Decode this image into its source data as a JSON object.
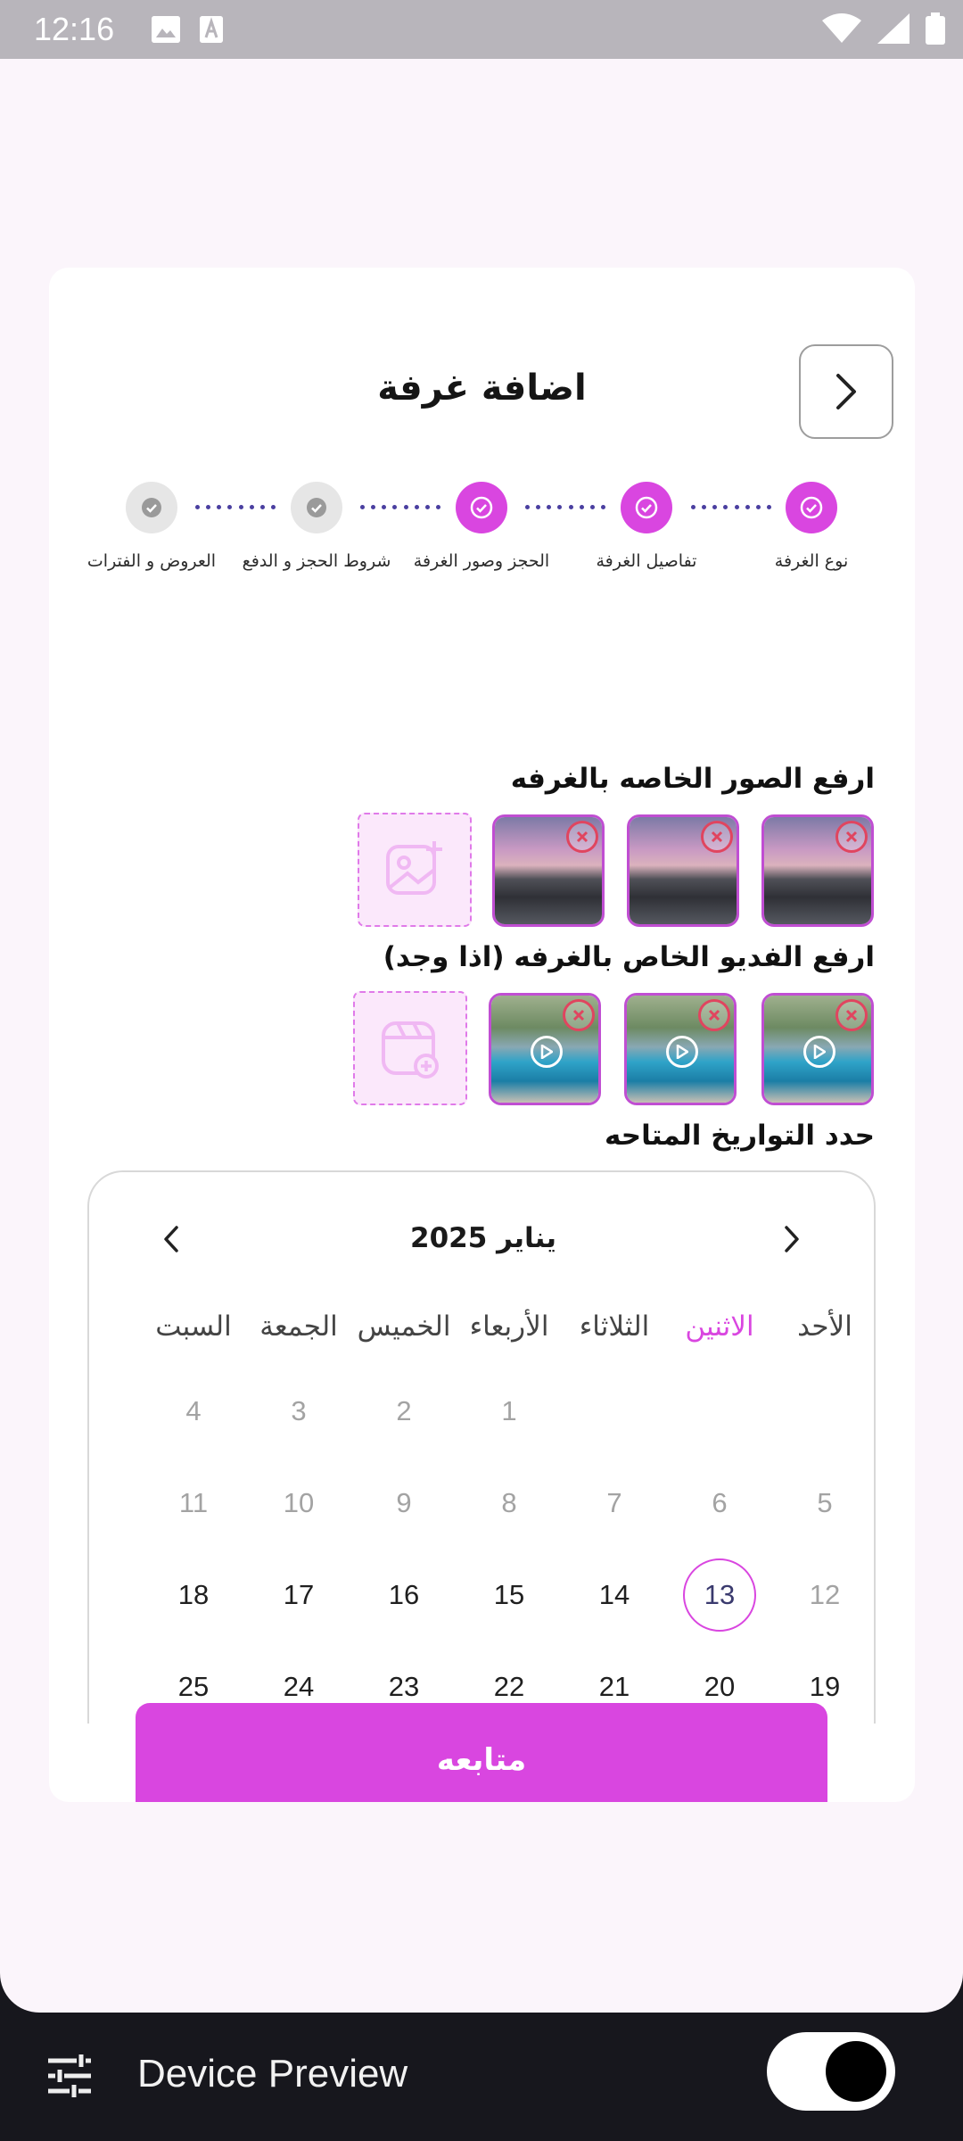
{
  "status_bar": {
    "time": "12:16"
  },
  "header": {
    "title": "اضافة غرفة"
  },
  "stepper": {
    "steps": [
      {
        "label": "نوع الغرفة",
        "state": "done"
      },
      {
        "label": "تفاصيل الغرفة",
        "state": "done"
      },
      {
        "label": "الحجز وصور الغرفة",
        "state": "done"
      },
      {
        "label": "شروط الحجز و الدفع",
        "state": "pending"
      },
      {
        "label": "العروض و الفترات",
        "state": "pending"
      }
    ]
  },
  "photos": {
    "label": "ارفع الصور الخاصه بالغرفه",
    "count": 3
  },
  "videos": {
    "label": "ارفع الفديو الخاص بالغرفه (اذا وجد)",
    "count": 3
  },
  "dates": {
    "label": "حدد التواريخ المتاحه"
  },
  "calendar": {
    "month_title": "يناير 2025",
    "weekdays": [
      "الأحد",
      "الاثنين",
      "الثلاثاء",
      "الأربعاء",
      "الخميس",
      "الجمعة",
      "السبت"
    ],
    "selected_weekday": "الاثنين",
    "rows": [
      [
        "",
        "",
        "",
        "1",
        "2",
        "3",
        "4"
      ],
      [
        "5",
        "6",
        "7",
        "8",
        "9",
        "10",
        "11"
      ],
      [
        "12",
        "13",
        "14",
        "15",
        "16",
        "17",
        "18"
      ],
      [
        "19",
        "20",
        "21",
        "22",
        "23",
        "24",
        "25"
      ]
    ],
    "today": "13"
  },
  "continue_button": {
    "label": "متابعه"
  },
  "device_preview": {
    "label": "Device Preview",
    "toggle_on": true
  },
  "colors": {
    "accent": "#d946e0",
    "remove": "#e0455f",
    "dots": "#4a3fa0"
  }
}
